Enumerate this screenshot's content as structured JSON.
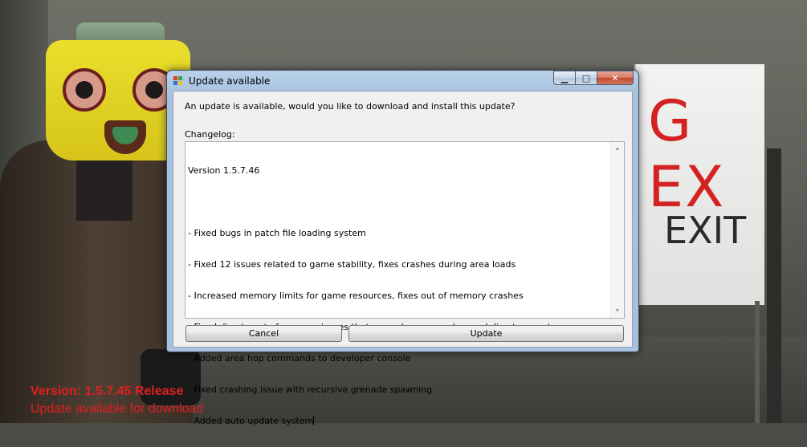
{
  "background": {
    "sign_text_red": "G EX",
    "sign_text_exit": "EXIT",
    "hud": {
      "version_text": "Version: 1.5.7.45 Release",
      "status_text": "Update available for download"
    }
  },
  "dialog": {
    "title": "Update available",
    "app_icon": "windows-form-icon",
    "window_buttons": {
      "minimize_glyph": "▁",
      "maximize_glyph": "□",
      "close_glyph": "✕"
    },
    "prompt": "An update is available, would you like to download and install this update?",
    "changelog_label": "Changelog:",
    "changelog_lines": [
      "Version 1.5.7.46",
      "",
      "- Fixed bugs in patch file loading system",
      "- Fixed 12 issues related to game stability, fixes crashes during area loads",
      "- Increased memory limits for game resources, fixes out of memory crashes",
      "- Fixed directx out of memory issues that caused game crashes and directx asserts",
      "- Added area hop commands to developer console",
      "- Fixed crashing issue with recursive grenade spawning",
      "- Added auto update system"
    ],
    "buttons": {
      "cancel": "Cancel",
      "update": "Update"
    }
  },
  "colors": {
    "hud_red": "#e02020",
    "sign_red": "#d42222"
  }
}
